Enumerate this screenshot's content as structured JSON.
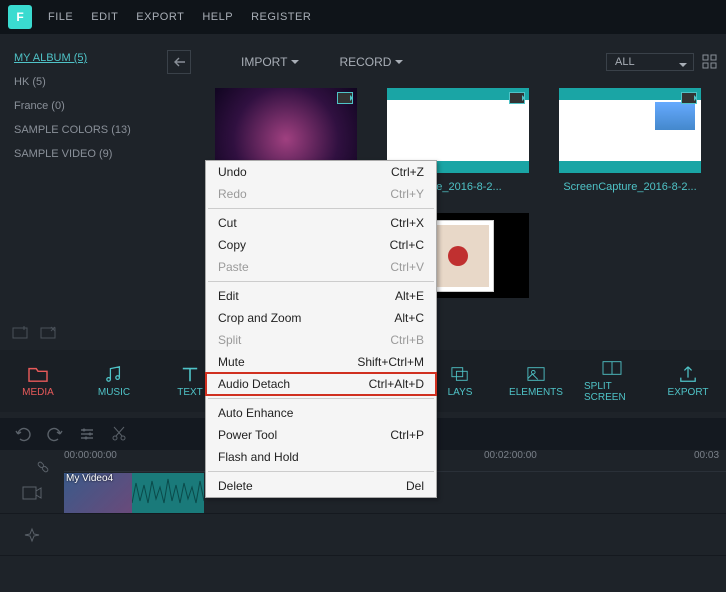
{
  "topbar": {
    "logo": "F",
    "menu": [
      "FILE",
      "EDIT",
      "EXPORT",
      "HELP",
      "REGISTER"
    ]
  },
  "sidebar": {
    "items": [
      {
        "label": "MY ALBUM (5)",
        "active": true
      },
      {
        "label": "HK (5)",
        "active": false
      },
      {
        "label": "France (0)",
        "active": false
      },
      {
        "label": "SAMPLE COLORS (13)",
        "active": false
      },
      {
        "label": "SAMPLE VIDEO (9)",
        "active": false
      }
    ]
  },
  "content": {
    "import": "IMPORT",
    "record": "RECORD",
    "filter": "ALL",
    "thumbs": [
      {
        "label": ""
      },
      {
        "label": "...ture_2016-8-2..."
      },
      {
        "label": "ScreenCapture_2016-8-2..."
      },
      {
        "label": ""
      }
    ]
  },
  "tabs": [
    {
      "label": "MEDIA",
      "active": true
    },
    {
      "label": "MUSIC",
      "active": false
    },
    {
      "label": "TEXT",
      "active": false
    },
    {
      "label": "LAYS",
      "active": false
    },
    {
      "label": "ELEMENTS",
      "active": false
    },
    {
      "label": "SPLIT SCREEN",
      "active": false
    },
    {
      "label": "EXPORT",
      "active": false
    }
  ],
  "timeline": {
    "ticks": [
      "00:00:00:00",
      "00:02:00:00",
      "00:03"
    ],
    "clip": {
      "label": "My Video4"
    }
  },
  "context_menu": [
    {
      "label": "Undo",
      "shortcut": "Ctrl+Z",
      "disabled": false
    },
    {
      "label": "Redo",
      "shortcut": "Ctrl+Y",
      "disabled": true
    },
    {
      "sep": true
    },
    {
      "label": "Cut",
      "shortcut": "Ctrl+X",
      "disabled": false
    },
    {
      "label": "Copy",
      "shortcut": "Ctrl+C",
      "disabled": false
    },
    {
      "label": "Paste",
      "shortcut": "Ctrl+V",
      "disabled": true
    },
    {
      "sep": true
    },
    {
      "label": "Edit",
      "shortcut": "Alt+E",
      "disabled": false
    },
    {
      "label": "Crop and Zoom",
      "shortcut": "Alt+C",
      "disabled": false
    },
    {
      "label": "Split",
      "shortcut": "Ctrl+B",
      "disabled": true
    },
    {
      "label": "Mute",
      "shortcut": "Shift+Ctrl+M",
      "disabled": false
    },
    {
      "label": "Audio Detach",
      "shortcut": "Ctrl+Alt+D",
      "disabled": false,
      "highlight": true
    },
    {
      "sep": true
    },
    {
      "label": "Auto Enhance",
      "shortcut": "",
      "disabled": false
    },
    {
      "label": "Power Tool",
      "shortcut": "Ctrl+P",
      "disabled": false
    },
    {
      "label": "Flash and Hold",
      "shortcut": "",
      "disabled": false
    },
    {
      "sep": true
    },
    {
      "label": "Delete",
      "shortcut": "Del",
      "disabled": false
    }
  ]
}
